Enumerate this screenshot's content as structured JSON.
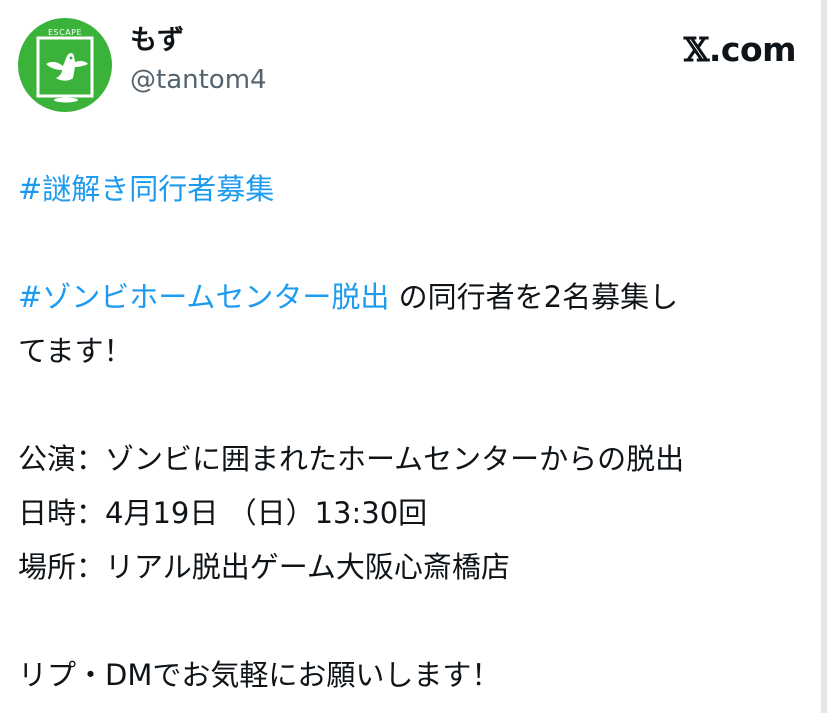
{
  "author": {
    "display_name": "もず",
    "handle": "@tantom4",
    "avatar_text": "ESCAPE",
    "avatar_color": "#3bb33b"
  },
  "brand": {
    "x_glyph": "𝕏",
    "suffix": ".com"
  },
  "tweet": {
    "line1_hashtag": "#謎解き同行者募集",
    "line2_hashtag": "#ゾンビホームセンター脱出",
    "line2_text": " の同行者を2名募集し",
    "line3_text": "てます！",
    "line4_text": "公演：ゾンビに囲まれたホームセンターからの脱出",
    "line5_text": "日時：4月19日 （日）13:30回",
    "line6_text": "場所：リアル脱出ゲーム大阪心斎橋店",
    "line7_text": "リプ・DMでお気軽にお願いします！"
  },
  "colors": {
    "hashtag": "#1d9bf0",
    "text": "#0f1419",
    "handle": "#536471"
  }
}
